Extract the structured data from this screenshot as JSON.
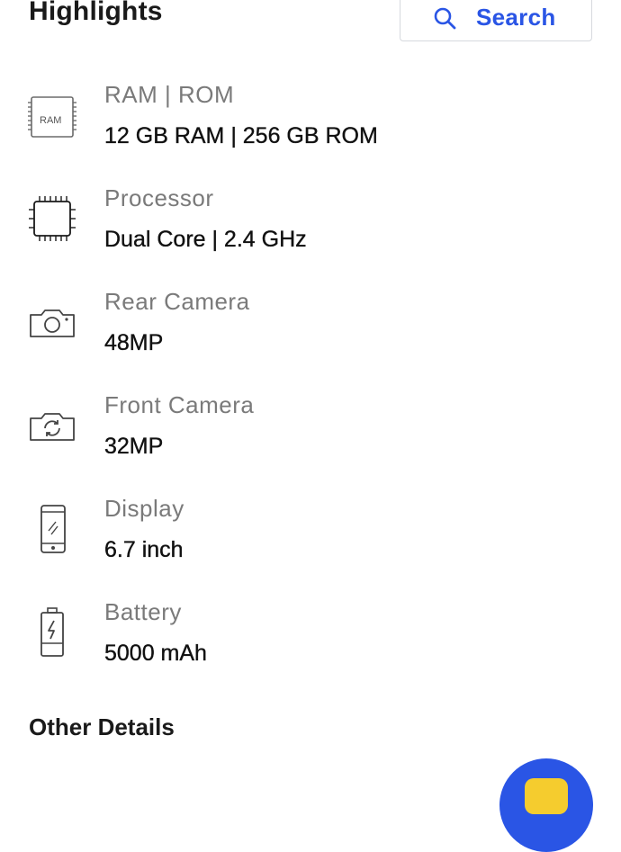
{
  "header": {
    "title": "Highlights",
    "search_label": "Search"
  },
  "highlights": [
    {
      "icon": "ram-chip-icon",
      "icon_text": "RAM",
      "label": "RAM | ROM",
      "value": "12 GB RAM | 256 GB ROM"
    },
    {
      "icon": "processor-icon",
      "label": "Processor",
      "value": "Dual Core | 2.4 GHz"
    },
    {
      "icon": "camera-icon",
      "label": "Rear Camera",
      "value": "48MP"
    },
    {
      "icon": "front-camera-icon",
      "label": "Front Camera",
      "value": "32MP"
    },
    {
      "icon": "phone-display-icon",
      "label": "Display",
      "value": "6.7 inch"
    },
    {
      "icon": "battery-icon",
      "label": "Battery",
      "value": "5000 mAh"
    }
  ],
  "other_details": {
    "title": "Other Details"
  },
  "colors": {
    "accent": "#2a55e5",
    "label_gray": "#7a7a7a",
    "fab_inner": "#f5cc2e"
  }
}
